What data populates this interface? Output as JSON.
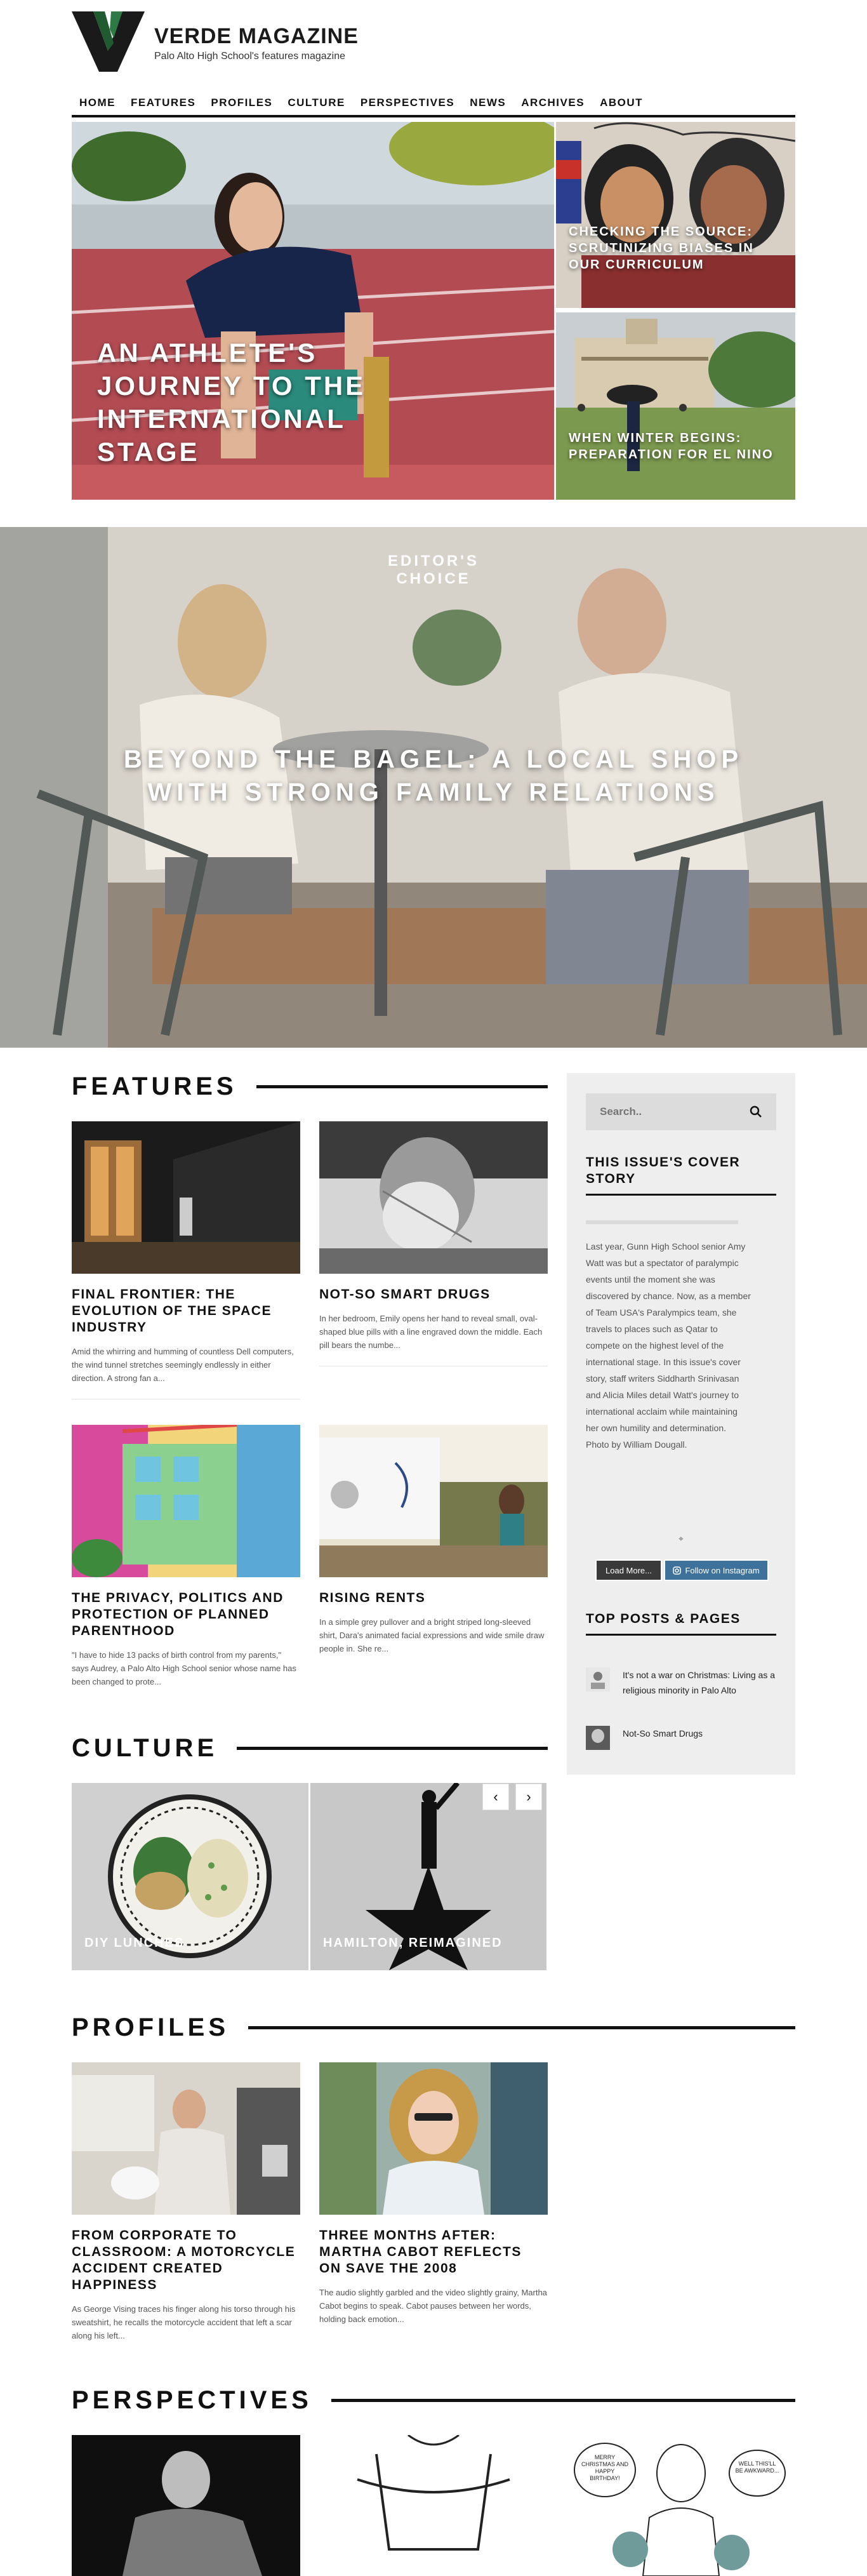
{
  "brand": {
    "title": "VERDE MAGAZINE",
    "subtitle": "Palo Alto High School's features magazine"
  },
  "nav": [
    "HOME",
    "FEATURES",
    "PROFILES",
    "CULTURE",
    "PERSPECTIVES",
    "NEWS",
    "ARCHIVES",
    "ABOUT"
  ],
  "hero": {
    "main_title": "AN ATHLETE'S JOURNEY TO THE INTERNATIONAL STAGE",
    "side1_title": "CHECKING THE SOURCE: SCRUTINIZING BIASES IN OUR CURRICULUM",
    "side2_title": "WHEN WINTER BEGINS: PREPARATION FOR EL NINO"
  },
  "editors": {
    "kicker": "EDITOR'S CHOICE",
    "title": "BEYOND THE BAGEL: A LOCAL SHOP WITH STRONG FAMILY RELATIONS"
  },
  "sections": {
    "features": "FEATURES",
    "culture": "CULTURE",
    "profiles": "PROFILES",
    "perspectives": "PERSPECTIVES"
  },
  "features": [
    {
      "title": "FINAL FRONTIER: THE EVOLUTION OF THE SPACE INDUSTRY",
      "excerpt": "Amid the whirring and humming of countless Dell computers, the wind tunnel stretches seemingly endlessly in either direction. A strong fan a..."
    },
    {
      "title": "NOT-SO SMART DRUGS",
      "excerpt": "In her bedroom, Emily opens her hand to reveal small, oval-shaped blue pills with a line engraved down the middle. Each pill bears the numbe..."
    },
    {
      "title": "THE PRIVACY, POLITICS AND PROTECTION OF PLANNED PARENTHOOD",
      "excerpt": "\"I have to hide 13 packs of birth control from my parents,\" says Audrey, a Palo Alto High School senior whose name has been changed to prote..."
    },
    {
      "title": "RISING RENTS",
      "excerpt": "In a simple grey pullover and a bright striped long-sleeved shirt, Dara's animated facial expressions and wide smile draw people in. She re..."
    }
  ],
  "sidebar": {
    "search_placeholder": "Search..",
    "cover_title": "THIS ISSUE'S COVER STORY",
    "cover_text": "Last year, Gunn High School senior Amy Watt was but a spectator of paralympic events until the moment she was discovered by chance. Now, as a member of Team USA's Paralympics team, she travels to places such as Qatar to compete on the highest level of the international stage. In this issue's cover story, staff writers Siddharth Srinivasan and Alicia Miles detail Watt's journey to international acclaim while maintaining her own humility and determination. Photo by William Dougall.",
    "spinner": "⌖",
    "load_more": "Load More...",
    "follow": "Follow on Instagram",
    "top_title": "TOP POSTS & PAGES",
    "top_posts": [
      "It's not a war on Christmas: Living as a religious minority in Palo Alto",
      "Not-So Smart Drugs"
    ]
  },
  "culture": [
    {
      "title": "DIY LUNCHES"
    },
    {
      "title": "HAMILTON, REIMAGINED"
    }
  ],
  "slider": {
    "prev": "‹",
    "next": "›"
  },
  "profiles": [
    {
      "title": "FROM CORPORATE TO CLASSROOM: A MOTORCYCLE ACCIDENT CREATED HAPPINESS",
      "excerpt": "As George Vising traces his finger along his torso through his sweatshirt, he recalls the motorcycle accident that left a scar along his left..."
    },
    {
      "title": "THREE MONTHS AFTER: MARTHA CABOT REFLECTS ON SAVE THE 2008",
      "excerpt": "The audio slightly garbled and the video slightly grainy, Martha Cabot begins to speak. Cabot pauses between her words, holding back emotion..."
    }
  ],
  "perspectives_art": {
    "bubble_left": "MERRY CHRISTMAS AND HAPPY BIRTHDAY!",
    "bubble_right": "WELL THIS'LL BE AWKWARD..."
  },
  "colors": {
    "brand_green": "#1f5a30",
    "instagram": "#3f729b",
    "rule": "#111111"
  }
}
